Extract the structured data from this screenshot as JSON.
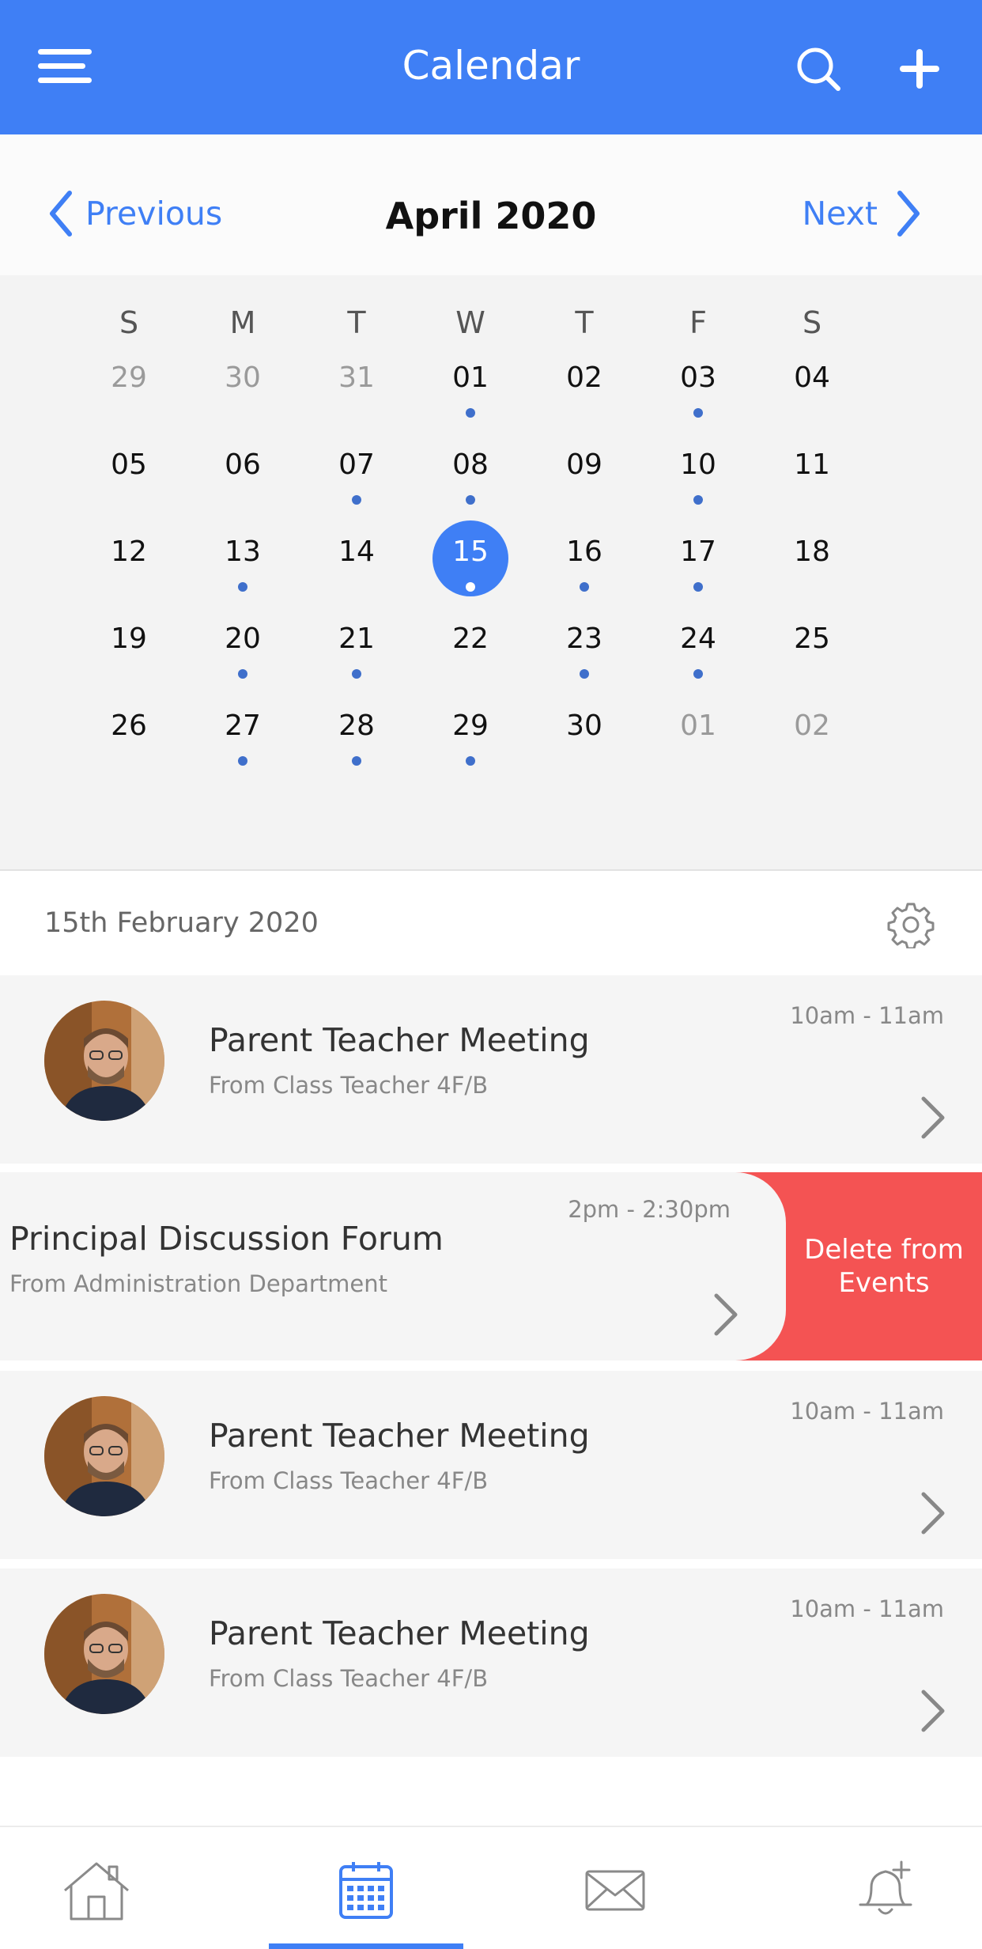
{
  "header": {
    "title": "Calendar",
    "icons": {
      "menu": "menu-icon",
      "search": "search-icon",
      "add": "plus-icon"
    }
  },
  "month_nav": {
    "previous_label": "Previous",
    "next_label": "Next",
    "month": "April 2020"
  },
  "calendar": {
    "weekdays": [
      "S",
      "M",
      "T",
      "W",
      "T",
      "F",
      "S"
    ],
    "weeks": [
      [
        {
          "d": "29",
          "m": true,
          "e": false
        },
        {
          "d": "30",
          "m": true,
          "e": false
        },
        {
          "d": "31",
          "m": true,
          "e": false
        },
        {
          "d": "01",
          "m": false,
          "e": true
        },
        {
          "d": "02",
          "m": false,
          "e": false
        },
        {
          "d": "03",
          "m": false,
          "e": true
        },
        {
          "d": "04",
          "m": false,
          "e": false
        }
      ],
      [
        {
          "d": "05",
          "m": false,
          "e": false
        },
        {
          "d": "06",
          "m": false,
          "e": false
        },
        {
          "d": "07",
          "m": false,
          "e": true
        },
        {
          "d": "08",
          "m": false,
          "e": true
        },
        {
          "d": "09",
          "m": false,
          "e": false
        },
        {
          "d": "10",
          "m": false,
          "e": true
        },
        {
          "d": "11",
          "m": false,
          "e": false
        }
      ],
      [
        {
          "d": "12",
          "m": false,
          "e": false
        },
        {
          "d": "13",
          "m": false,
          "e": true
        },
        {
          "d": "14",
          "m": false,
          "e": false
        },
        {
          "d": "15",
          "m": false,
          "e": true,
          "s": true
        },
        {
          "d": "16",
          "m": false,
          "e": true
        },
        {
          "d": "17",
          "m": false,
          "e": true
        },
        {
          "d": "18",
          "m": false,
          "e": false
        }
      ],
      [
        {
          "d": "19",
          "m": false,
          "e": false
        },
        {
          "d": "20",
          "m": false,
          "e": true
        },
        {
          "d": "21",
          "m": false,
          "e": true
        },
        {
          "d": "22",
          "m": false,
          "e": false
        },
        {
          "d": "23",
          "m": false,
          "e": true
        },
        {
          "d": "24",
          "m": false,
          "e": true
        },
        {
          "d": "25",
          "m": false,
          "e": false
        }
      ],
      [
        {
          "d": "26",
          "m": false,
          "e": false
        },
        {
          "d": "27",
          "m": false,
          "e": true
        },
        {
          "d": "28",
          "m": false,
          "e": true
        },
        {
          "d": "29",
          "m": false,
          "e": true
        },
        {
          "d": "30",
          "m": false,
          "e": false
        },
        {
          "d": "01",
          "m": true,
          "e": false
        },
        {
          "d": "02",
          "m": true,
          "e": false
        }
      ]
    ],
    "selected_color": "#3F7FF5",
    "event_dot_color": "#3F6FCB"
  },
  "events_section": {
    "date_label": "15th February 2020",
    "settings_icon": "gear-icon"
  },
  "events": [
    {
      "title": "Parent Teacher Meeting",
      "subtitle": "From Class Teacher 4F/B",
      "time": "10am - 11am",
      "has_avatar": true
    },
    {
      "title": "Principal Discussion Forum",
      "subtitle": "From Administration Department",
      "time": "2pm - 2:30pm",
      "has_avatar": false,
      "swiped": true,
      "action": "Delete from Events"
    },
    {
      "title": "Parent Teacher Meeting",
      "subtitle": "From Class Teacher 4F/B",
      "time": "10am - 11am",
      "has_avatar": true
    },
    {
      "title": "Parent Teacher Meeting",
      "subtitle": "From Class Teacher 4F/B",
      "time": "10am - 11am",
      "has_avatar": true
    }
  ],
  "bottom_nav": {
    "tabs": [
      {
        "icon": "home-icon",
        "active": false
      },
      {
        "icon": "calendar-icon",
        "active": true
      },
      {
        "icon": "mail-icon",
        "active": false
      },
      {
        "icon": "bell-plus-icon",
        "active": false
      }
    ],
    "active_color": "#3F7FF5",
    "delete_color": "#F45353"
  }
}
